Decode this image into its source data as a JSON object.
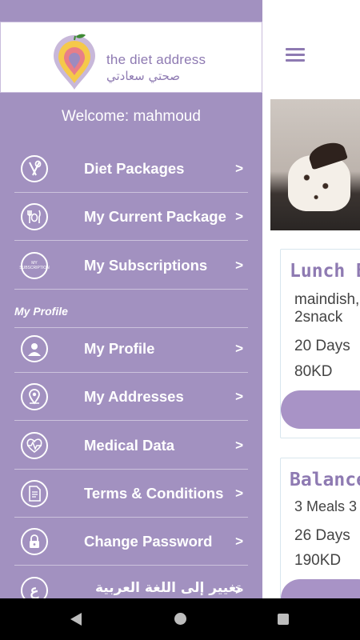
{
  "header": {
    "logo_text_en": "the diet address",
    "logo_text_ar": "صحتي سعادتي"
  },
  "drawer": {
    "welcome": "Welcome: mahmoud",
    "section_profile": "My Profile",
    "chevron": ">",
    "items": [
      {
        "label": "Diet Packages",
        "icon": "fork-spoon-icon"
      },
      {
        "label": "My Current Package",
        "icon": "fork-knife-icon"
      },
      {
        "label": "My Subscriptions",
        "icon": "subscription-icon",
        "icon_text": "MY SUBSCRIPTION"
      },
      {
        "label": "My Profile",
        "icon": "user-icon"
      },
      {
        "label": "My Addresses",
        "icon": "location-pin-icon"
      },
      {
        "label": "Medical Data",
        "icon": "heartbeat-icon"
      },
      {
        "label": "Terms & Conditions",
        "icon": "document-icon"
      },
      {
        "label": "Change Password",
        "icon": "lock-icon"
      },
      {
        "label": "تغيير إلى اللغة العربية",
        "icon": "arabic-letter-icon",
        "icon_text": "ع"
      }
    ]
  },
  "packages": [
    {
      "title": "Lunch B",
      "description_line1": "maindish,d",
      "description_line2": "2snack",
      "days": "20 Days",
      "price": "80KD"
    },
    {
      "title": "Balance",
      "description_line1": "3 Meals  3",
      "days": "26 Days",
      "price": "190KD"
    }
  ],
  "colors": {
    "drawer_bg": "#a291c0",
    "accent": "#8e7ab2",
    "button": "#a893c6"
  }
}
